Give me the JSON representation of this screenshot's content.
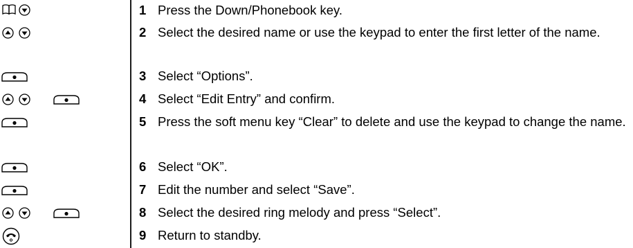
{
  "steps": [
    {
      "number": "1",
      "text": "Press the Down/Phonebook key.",
      "icons": [
        "book-icon",
        "down-arrow-icon"
      ]
    },
    {
      "number": "2",
      "text": "Select the desired name or use the keypad to enter the first letter of the name.",
      "icons": [
        "up-arrow-icon",
        "down-arrow-icon"
      ]
    },
    {
      "number": "3",
      "text": "Select “Options”.",
      "icons": [
        "soft-key-icon"
      ]
    },
    {
      "number": "4",
      "text": "Select “Edit Entry” and confirm.",
      "icons": [
        "up-arrow-icon",
        "down-arrow-icon",
        "soft-key-icon"
      ]
    },
    {
      "number": "5",
      "text": "Press the soft menu key “Clear” to delete and use the keypad to change the name.",
      "icons": [
        "soft-key-icon"
      ]
    },
    {
      "number": "6",
      "text": "Select “OK”.",
      "icons": [
        "soft-key-icon"
      ]
    },
    {
      "number": "7",
      "text": "Edit the number and select “Save”.",
      "icons": [
        "soft-key-icon"
      ]
    },
    {
      "number": "8",
      "text": "Select the desired ring melody and press “Select”.",
      "icons": [
        "up-arrow-icon",
        "down-arrow-icon",
        "soft-key-icon"
      ]
    },
    {
      "number": "9",
      "text": "Return to standby.",
      "icons": [
        "end-call-icon"
      ]
    }
  ]
}
